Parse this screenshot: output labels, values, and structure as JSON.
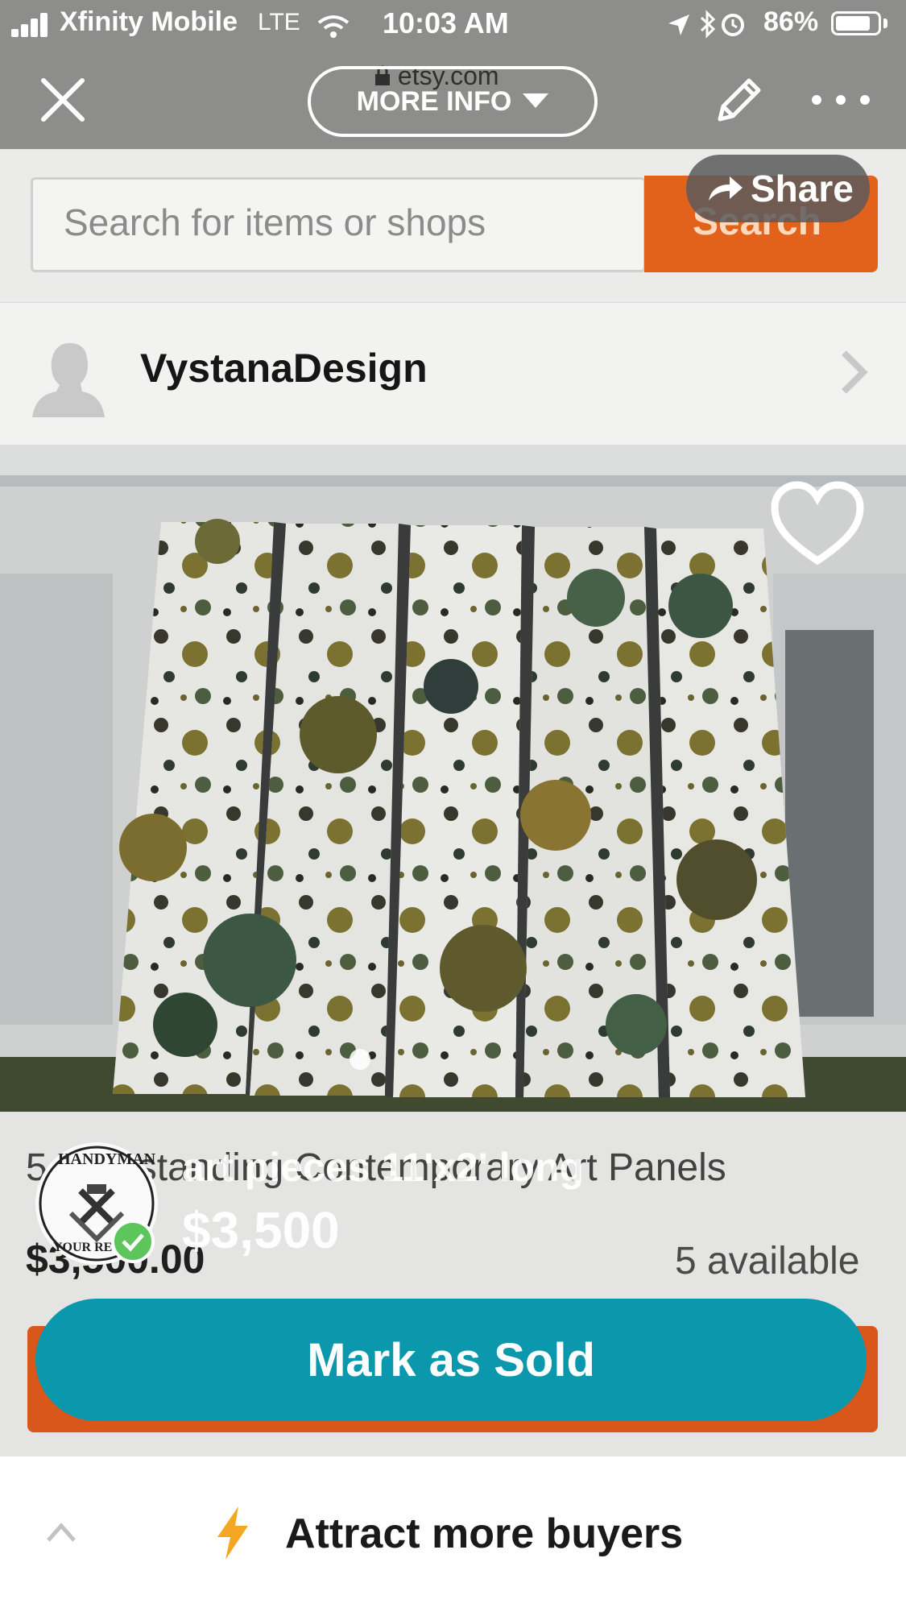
{
  "status_bar": {
    "carrier": "Xfinity Mobile",
    "network": "LTE",
    "time": "10:03 AM",
    "battery": "86%"
  },
  "header": {
    "more_info_label": "MORE INFO",
    "url": "etsy.com"
  },
  "etsy": {
    "search_placeholder": "Search for items or shops",
    "search_button": "Search",
    "share_label": "Share",
    "shop_name": "VystanaDesign",
    "listing_title": "5 Freestanding Contemporary Art Panels",
    "listing_price": "$3,500.00",
    "available": "5 available"
  },
  "overlay": {
    "title": "art pieces 11'x2' long",
    "price": "$3,500",
    "mark_sold_label": "Mark as Sold",
    "logo_text_top": "HANDYMAN",
    "logo_text_bottom": "YOUR RE"
  },
  "bottom_bar": {
    "promo_label": "Attract more buyers"
  },
  "colors": {
    "etsy_orange": "#e3621b",
    "teal_button": "#0b97ac",
    "bolt": "#f5a623"
  },
  "icons": [
    "close-icon",
    "chevron-down-icon",
    "lock-icon",
    "pencil-icon",
    "more-icon",
    "share-arrow-icon",
    "avatar-icon",
    "chevron-right-icon",
    "heart-icon",
    "checkmark-icon",
    "chevron-up-icon",
    "bolt-icon"
  ]
}
